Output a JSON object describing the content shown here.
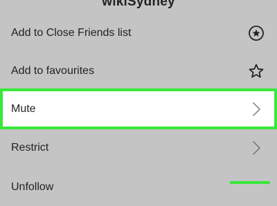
{
  "header": {
    "title": "wikiSydney"
  },
  "menu": {
    "items": [
      {
        "label": "Add to Close Friends list",
        "icon": "close-friends-star-circle-icon"
      },
      {
        "label": "Add to favourites",
        "icon": "star-outline-icon"
      },
      {
        "label": "Mute",
        "icon": "chevron-right-icon",
        "highlighted": true
      },
      {
        "label": "Restrict",
        "icon": "chevron-right-icon"
      },
      {
        "label": "Unfollow"
      }
    ]
  },
  "colors": {
    "background": "#c4c4c4",
    "highlight_border": "#38e83a",
    "highlight_fill": "#ffffff",
    "text": "#222222"
  }
}
